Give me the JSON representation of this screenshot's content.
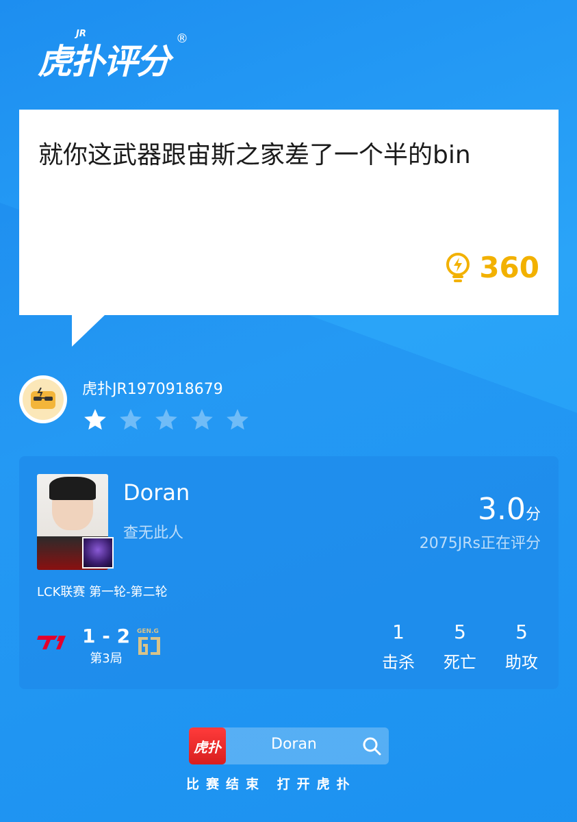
{
  "logo": {
    "text": "虎扑评分",
    "superscript": "JR",
    "registered": "®"
  },
  "comment": {
    "text": "就你这武器跟宙斯之家差了一个半的bin",
    "likes": "360",
    "like_color": "#f2b100"
  },
  "user": {
    "name": "虎扑JR1970918679",
    "rating_stars": 1,
    "max_stars": 5
  },
  "player": {
    "name": "Doran",
    "team_status": "查无此人",
    "score": "3.0",
    "score_unit": "分",
    "raters": "2075JRs正在评分",
    "league": "LCK联赛 第一轮-第二轮"
  },
  "match": {
    "team_left_logo": "T1",
    "team_right_logo": "GEN.G",
    "series_score": "1 - 2",
    "game": "第3局"
  },
  "kda": [
    {
      "value": "1",
      "label": "击杀"
    },
    {
      "value": "5",
      "label": "死亡"
    },
    {
      "value": "5",
      "label": "助攻"
    }
  ],
  "search": {
    "app_icon_text": "虎扑",
    "query": "Doran",
    "icon": "search-icon"
  },
  "footer": {
    "text": "比赛结束 打开虎扑"
  },
  "colors": {
    "background": "#1d8ef0",
    "accent_gold": "#f2b100",
    "app_red": "#e02424"
  }
}
